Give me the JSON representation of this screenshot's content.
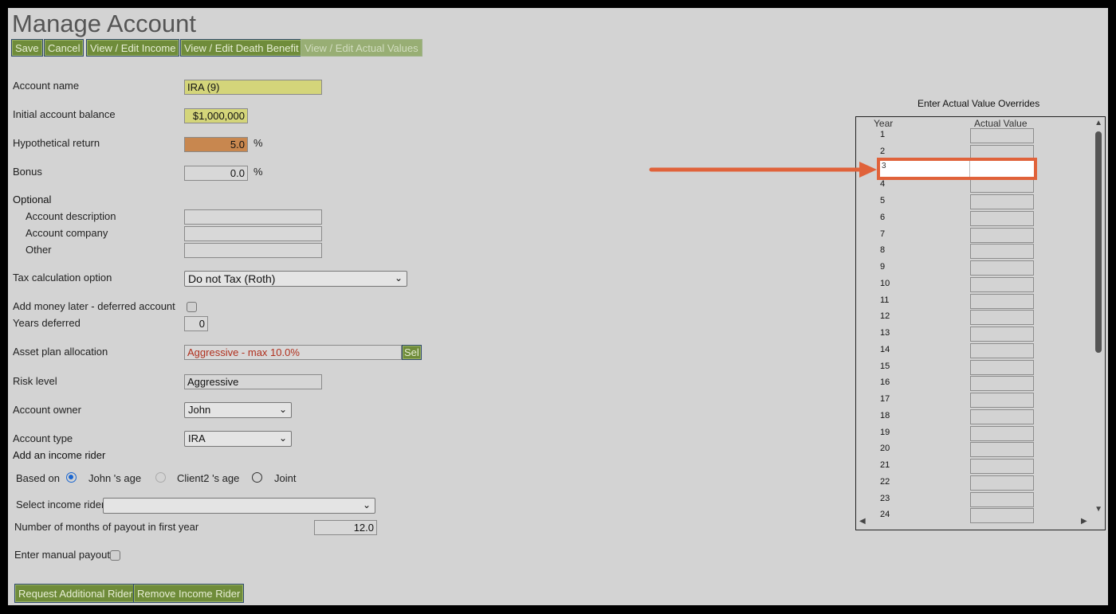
{
  "title": "Manage Account",
  "toolbar": {
    "save": "Save",
    "cancel": "Cancel",
    "income": "View / Edit Income",
    "death_benefit": "View / Edit Death Benefit",
    "actual_values": "View / Edit Actual Values"
  },
  "form": {
    "account_name_label": "Account name",
    "account_name_value": "IRA (9)",
    "initial_balance_label": "Initial account balance",
    "initial_balance_value": "$1,000,000",
    "hypo_return_label": "Hypothetical return",
    "hypo_return_value": "5.0",
    "hypo_return_unit": "%",
    "bonus_label": "Bonus",
    "bonus_value": "0.0",
    "bonus_unit": "%",
    "optional_label": "Optional",
    "account_description_label": "Account description",
    "account_company_label": "Account company",
    "other_label": "Other",
    "tax_label": "Tax calculation option",
    "tax_value": "Do not Tax (Roth)",
    "add_money_label": "Add money later - deferred account",
    "years_deferred_label": "Years deferred",
    "years_deferred_value": "0",
    "asset_plan_label": "Asset plan allocation",
    "asset_plan_value": "Aggressive - max 10.0%",
    "asset_plan_button": "Sel",
    "risk_label": "Risk level",
    "risk_value": "Aggressive",
    "owner_label": "Account owner",
    "owner_value": "John",
    "type_label": "Account type",
    "type_value": "IRA"
  },
  "rider": {
    "heading": "Add an income rider",
    "based_on_label": "Based on",
    "option_john": "John 's age",
    "option_client2": "Client2 's age",
    "option_joint": "Joint",
    "select_label": "Select income rider",
    "select_value": "",
    "months_label": "Number of months of payout in first year",
    "months_value": "12.0",
    "manual_payout_label": "Enter manual payout",
    "request_button": "Request Additional Rider",
    "remove_button": "Remove Income Rider"
  },
  "overrides": {
    "title": "Enter Actual Value Overrides",
    "col_year": "Year",
    "col_value": "Actual Value",
    "years": [
      "1",
      "2",
      "3",
      "4",
      "5",
      "6",
      "7",
      "8",
      "9",
      "10",
      "11",
      "12",
      "13",
      "14",
      "15",
      "16",
      "17",
      "18",
      "19",
      "20",
      "21",
      "22",
      "23",
      "24"
    ],
    "highlighted_year": "3",
    "highlight_color": "#e0623a"
  },
  "icons": {
    "dropdown": "chevron-down-icon",
    "arrow": "right-arrow-annotation-icon",
    "scroll_up": "scroll-up-icon",
    "scroll_down": "scroll-down-icon",
    "scroll_left": "scroll-left-icon",
    "scroll_right": "scroll-right-icon"
  }
}
